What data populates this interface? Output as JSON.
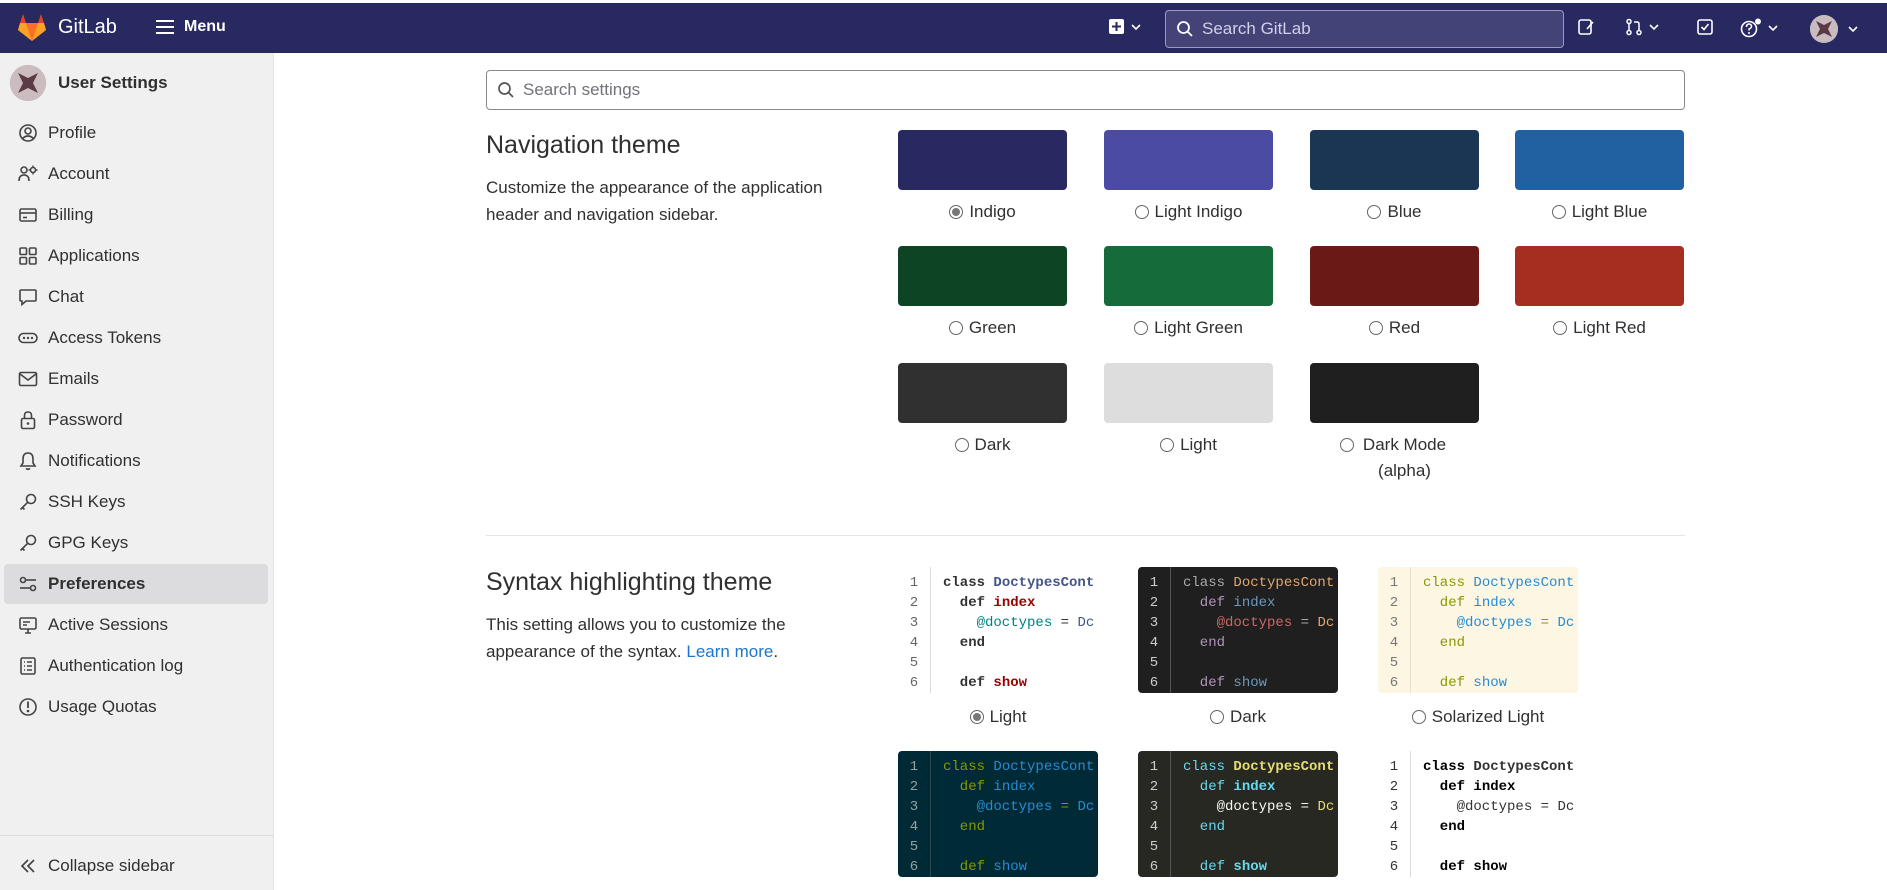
{
  "header": {
    "brand": "GitLab",
    "menu_label": "Menu",
    "search_placeholder": "Search GitLab"
  },
  "sidebar": {
    "title": "User Settings",
    "items": [
      {
        "label": "Profile",
        "icon": "profile-icon"
      },
      {
        "label": "Account",
        "icon": "account-icon"
      },
      {
        "label": "Billing",
        "icon": "billing-icon"
      },
      {
        "label": "Applications",
        "icon": "applications-icon"
      },
      {
        "label": "Chat",
        "icon": "chat-icon"
      },
      {
        "label": "Access Tokens",
        "icon": "token-icon"
      },
      {
        "label": "Emails",
        "icon": "mail-icon"
      },
      {
        "label": "Password",
        "icon": "lock-icon"
      },
      {
        "label": "Notifications",
        "icon": "bell-icon"
      },
      {
        "label": "SSH Keys",
        "icon": "key-icon"
      },
      {
        "label": "GPG Keys",
        "icon": "key-icon"
      },
      {
        "label": "Preferences",
        "icon": "preferences-icon",
        "active": true
      },
      {
        "label": "Active Sessions",
        "icon": "monitor-icon"
      },
      {
        "label": "Authentication log",
        "icon": "log-icon"
      },
      {
        "label": "Usage Quotas",
        "icon": "quota-icon"
      }
    ],
    "collapse_label": "Collapse sidebar"
  },
  "main": {
    "search_placeholder": "Search settings",
    "navigation_theme": {
      "title": "Navigation theme",
      "description": "Customize the appearance of the application header and navigation sidebar.",
      "themes": [
        {
          "label": "Indigo",
          "color": "#292961",
          "checked": true
        },
        {
          "label": "Light Indigo",
          "color": "#4b4ba3",
          "checked": false
        },
        {
          "label": "Blue",
          "color": "#1a3652",
          "checked": false
        },
        {
          "label": "Light Blue",
          "color": "#2261a1",
          "checked": false
        },
        {
          "label": "Green",
          "color": "#0d4524",
          "checked": false
        },
        {
          "label": "Light Green",
          "color": "#156b39",
          "checked": false
        },
        {
          "label": "Red",
          "color": "#691a16",
          "checked": false
        },
        {
          "label": "Light Red",
          "color": "#a62e21",
          "checked": false
        },
        {
          "label": "Dark",
          "color": "#303030",
          "checked": false
        },
        {
          "label": "Light",
          "color": "#dddddd",
          "checked": false
        },
        {
          "label": "Dark Mode (alpha)",
          "color": "#1f1f1f",
          "checked": false
        }
      ]
    },
    "syntax_theme": {
      "title": "Syntax highlighting theme",
      "description": "This setting allows you to customize the appearance of the syntax.",
      "learn_more": "Learn more",
      "line_numbers": "1\n2\n3\n4\n5\n6",
      "themes": [
        {
          "label": "Light",
          "checked": true
        },
        {
          "label": "Dark",
          "checked": false
        },
        {
          "label": "Solarized Light",
          "checked": false
        },
        {
          "label": "",
          "checked": false
        },
        {
          "label": "",
          "checked": false
        },
        {
          "label": "",
          "checked": false
        }
      ],
      "code_lines": {
        "l1_kw": "class ",
        "l1_name": "DoctypesCont",
        "l2_kw": "  def ",
        "l2_name": "index",
        "l3_var": "    @doctypes",
        "l3_op": " = ",
        "l3_rest": "Dc",
        "l4": "  end",
        "l6_kw": "  def ",
        "l6_name": "show"
      }
    }
  }
}
